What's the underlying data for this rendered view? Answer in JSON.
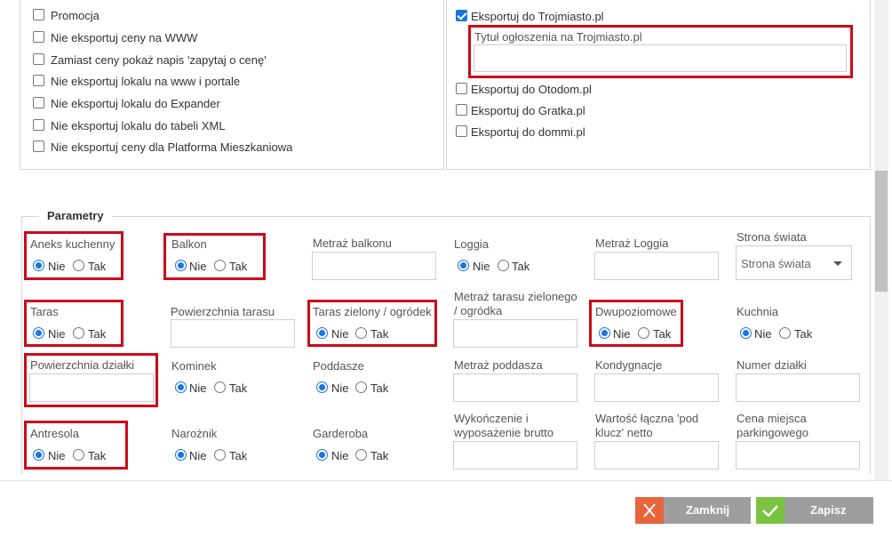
{
  "left_options": [
    {
      "label": "Promocja",
      "checked": false
    },
    {
      "label": "Nie eksportuj ceny na WWW",
      "checked": false
    },
    {
      "label": "Zamiast ceny pokaż napis 'zapytaj o cenę'",
      "checked": false
    },
    {
      "label": "Nie eksportuj lokalu na www i portale",
      "checked": false
    },
    {
      "label": "Nie eksportuj lokalu do Expander",
      "checked": false
    },
    {
      "label": "Nie eksportuj lokalu do tabeli XML",
      "checked": false
    },
    {
      "label": "Nie eksportuj ceny dla Platforma Mieszkaniowa",
      "checked": false
    }
  ],
  "export": {
    "trojmiasto": {
      "label": "Eksportuj do Trojmiasto.pl",
      "checked": true
    },
    "title_label": "Tytuł ogłoszenia na Trojmiasto.pl",
    "title_value": "",
    "otodom": {
      "label": "Eksportuj do Otodom.pl",
      "checked": false
    },
    "gratka": {
      "label": "Eksportuj do Gratka.pl",
      "checked": false
    },
    "dommi": {
      "label": "Eksportuj do dommi.pl",
      "checked": false
    }
  },
  "params": {
    "legend": "Parametry",
    "nie": "Nie",
    "tak": "Tak",
    "aneks": "Aneks kuchenny",
    "balkon": "Balkon",
    "metraz_balkonu": "Metraż balkonu",
    "loggia": "Loggia",
    "metraz_loggia": "Metraż Loggia",
    "strona_swiata": "Strona świata",
    "strona_swiata_value": "Strona świata",
    "taras": "Taras",
    "pow_tarasu": "Powierzchnia tarasu",
    "taras_zielony": "Taras zielony / ogródek",
    "metraz_tarasu_zielonego": "Metraż tarasu zielonego / ogródka",
    "dwupoziomowe": "Dwupoziomowe",
    "kuchnia": "Kuchnia",
    "pow_dzialki": "Powierzchnia działki",
    "kominek": "Kominek",
    "poddasze": "Poddasze",
    "metraz_poddasza": "Metraż poddasza",
    "kondygnacje": "Kondygnacje",
    "numer_dzialki": "Numer działki",
    "antresola": "Antresola",
    "naroznik": "Narożnik",
    "garderoba": "Garderoba",
    "wykonczenie": "Wykończenie i wyposażenie brutto",
    "wartosc": "Wartość łączna 'pod klucz' netto",
    "cena_parking": "Cena miejsca parkingowego"
  },
  "buttons": {
    "close": "Zamknij",
    "save": "Zapisz"
  },
  "colors": {
    "close_bg": "#9e9e9e",
    "close_icon_bg": "#e8643c",
    "save_bg": "#9e9e9e",
    "save_icon_bg": "#7cc242",
    "highlight": "#cc0a1a"
  }
}
